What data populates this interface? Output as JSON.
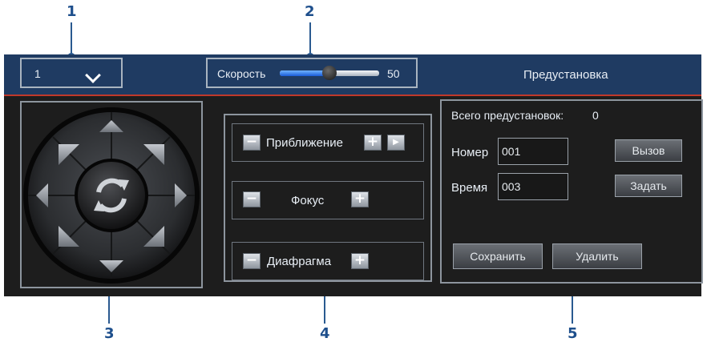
{
  "callouts": {
    "c1": "1",
    "c2": "2",
    "c3": "3",
    "c4": "4",
    "c5": "5"
  },
  "channel": {
    "selected": "1"
  },
  "speed": {
    "label": "Скорость",
    "value": "50",
    "level_fraction": 0.5
  },
  "preset_header": "Предустановка",
  "lens": {
    "zoom_label": "Приближение",
    "focus_label": "Фокус",
    "iris_label": "Диафрагма",
    "minus_symbol": "−",
    "plus_symbol": "+",
    "play_symbol": "▶"
  },
  "preset": {
    "total_label": "Всего предустановок:",
    "total_value": "0",
    "number_label": "Номер",
    "number_value": "001",
    "time_label": "Время",
    "time_value": "003",
    "call_button": "Вызов",
    "set_button": "Задать",
    "save_button": "Сохранить",
    "delete_button": "Удалить"
  },
  "colors": {
    "bar": "#1f3b62",
    "panel": "#1d1d1d",
    "callout": "#1e4f8c",
    "accent_line": "#c0392b"
  },
  "icons": [
    "chevron-down-icon",
    "refresh-icon",
    "arrow-up-icon",
    "arrow-down-icon",
    "arrow-left-icon",
    "arrow-right-icon"
  ]
}
